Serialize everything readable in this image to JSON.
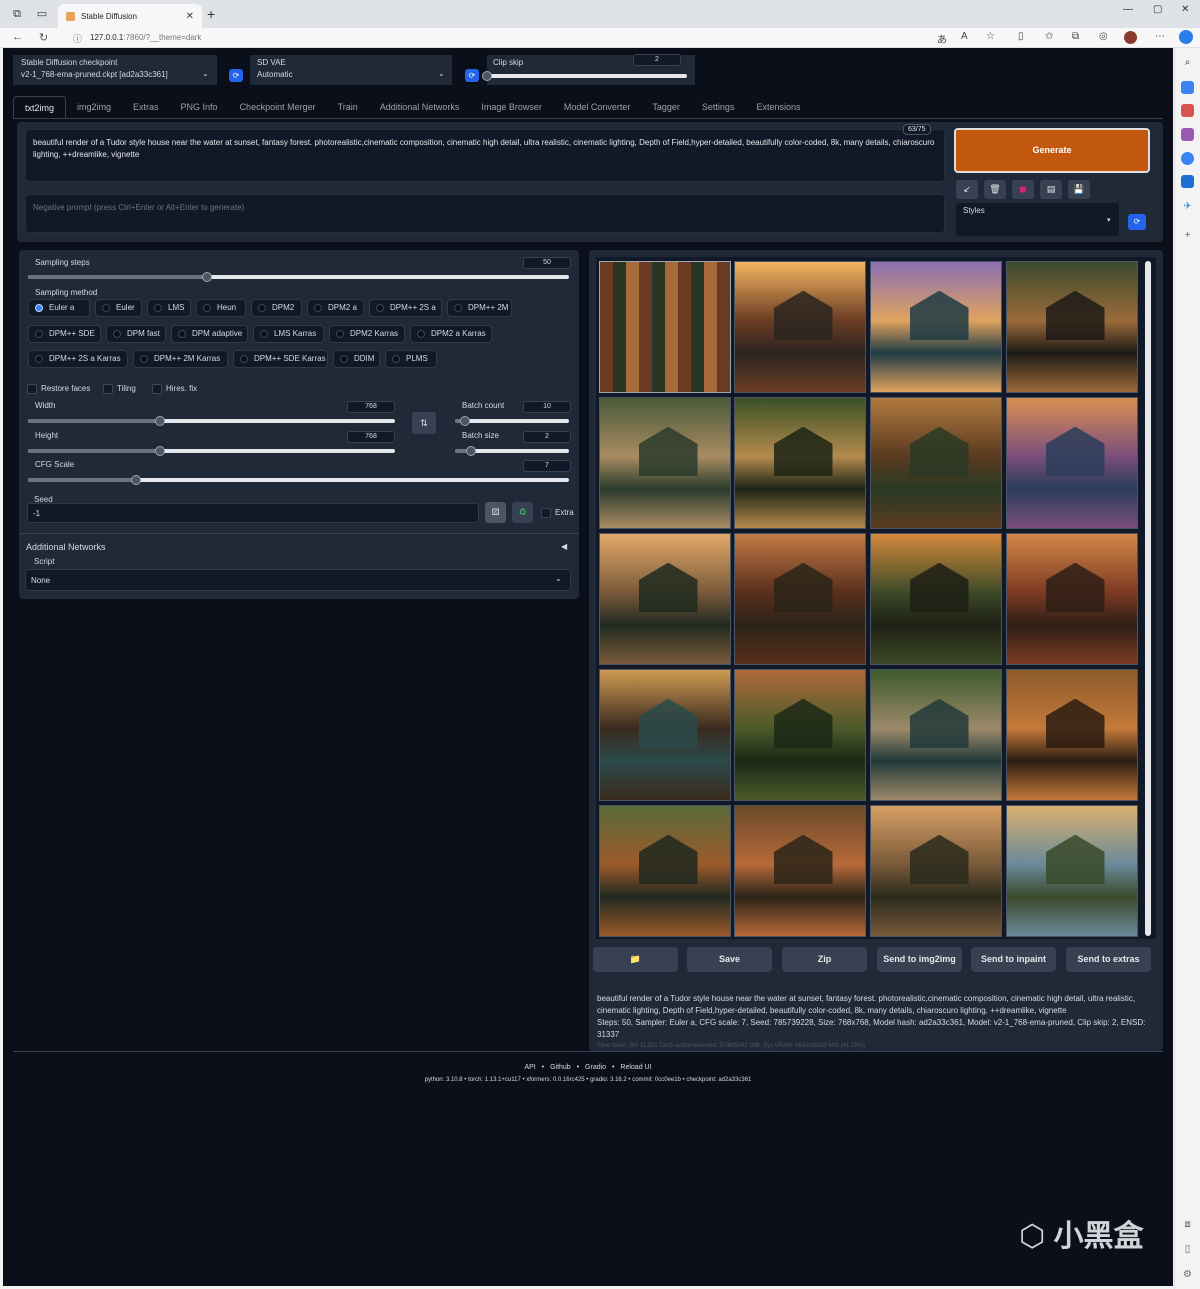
{
  "browser": {
    "tab_title": "Stable Diffusion",
    "url_host": "127.0.0.1",
    "url_rest": ":7860/?__theme=dark"
  },
  "top": {
    "checkpoint_label": "Stable Diffusion checkpoint",
    "checkpoint_value": "v2-1_768-ema-pruned.ckpt [ad2a33c361]",
    "vae_label": "SD VAE",
    "vae_value": "Automatic",
    "clip_label": "Clip skip",
    "clip_value": "2",
    "clip_fraction": 0.0
  },
  "tabs": [
    "txt2img",
    "img2img",
    "Extras",
    "PNG Info",
    "Checkpoint Merger",
    "Train",
    "Additional Networks",
    "Image Browser",
    "Model Converter",
    "Tagger",
    "Settings",
    "Extensions"
  ],
  "prompt": {
    "text": "beautiful render of a Tudor style house near the water at sunset, fantasy forest. photorealistic,cinematic composition, cinematic high detail, ultra realistic, cinematic lighting, Depth of Field,hyper-detailed, beautifully color-coded, 8k, many details, chiaroscuro lighting, ++dreamlike, vignette",
    "counter": "63/75",
    "negative_placeholder": "Negative prompt (press Ctrl+Enter or Alt+Enter to generate)"
  },
  "generate_label": "Generate",
  "styles_label": "Styles",
  "tool_icons": [
    "check-icon",
    "trash-icon",
    "picture-icon",
    "clipboard-icon",
    "save-icon"
  ],
  "sampling": {
    "steps_label": "Sampling steps",
    "steps_value": "50",
    "steps_fraction": 0.33,
    "method_label": "Sampling method",
    "methods_row1": [
      "Euler a",
      "Euler",
      "LMS",
      "Heun",
      "DPM2",
      "DPM2 a",
      "DPM++ 2S a",
      "DPM++ 2M"
    ],
    "methods_row2": [
      "DPM++ SDE",
      "DPM fast",
      "DPM adaptive",
      "LMS Karras",
      "DPM2 Karras",
      "DPM2 a Karras"
    ],
    "methods_row3": [
      "DPM++ 2S a Karras",
      "DPM++ 2M Karras",
      "DPM++ SDE Karras",
      "DDIM",
      "PLMS"
    ],
    "selected": "Euler a"
  },
  "checks": {
    "restore_faces": "Restore faces",
    "tiling": "Tiling",
    "hires": "Hires. fix"
  },
  "dims": {
    "width_label": "Width",
    "width_value": "768",
    "width_fraction": 0.36,
    "height_label": "Height",
    "height_value": "768",
    "height_fraction": 0.36,
    "batch_count_label": "Batch count",
    "batch_count_value": "10",
    "batch_count_fraction": 0.09,
    "batch_size_label": "Batch size",
    "batch_size_value": "2",
    "batch_size_fraction": 0.14,
    "cfg_label": "CFG Scale",
    "cfg_value": "7",
    "cfg_fraction": 0.2
  },
  "seed": {
    "label": "Seed",
    "value": "-1",
    "extra": "Extra"
  },
  "additional_networks": "Additional Networks",
  "script": {
    "label": "Script",
    "value": "None"
  },
  "output_buttons": [
    "Save",
    "Zip",
    "Send to img2img",
    "Send to inpaint",
    "Send to extras"
  ],
  "info": {
    "prompt": "beautiful render of a Tudor style house near the water at sunset, fantasy forest. photorealistic,cinematic composition, cinematic high detail, ultra realistic, cinematic lighting, Depth of Field,hyper-detailed, beautifully color-coded, 8k, many details, chiaroscuro lighting, ++dreamlike, vignette",
    "params": "Steps: 50, Sampler: Euler a, CFG scale: 7, Seed: 785739228, Size: 768x768, Model hash: ad2a33c361, Model: v2-1_768-ema-pruned, Clip skip: 2, ENSD: 31337",
    "time": "Time taken: 5m 11.32s  Torch active/reserved: 3746/5042 MiB, Sys VRAM: 6843/16380 MiB (41.78%)"
  },
  "footer": {
    "links": [
      "API",
      "Github",
      "Gradio",
      "Reload UI"
    ],
    "versions": "python: 3.10.8  •  torch: 1.13.1+cu117  •  xformers: 0.0.16rc425  •  gradio: 3.16.2  •  commit: 0cc0ee1b  •  checkpoint: ad2a33c361"
  },
  "watermark": "小黑盒"
}
